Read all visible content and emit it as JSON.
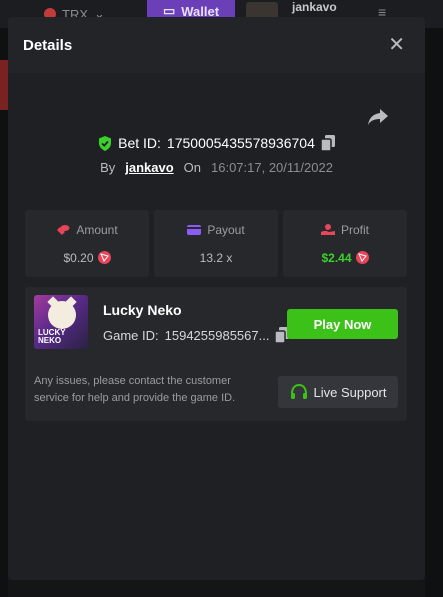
{
  "background": {
    "coin_label": "TRX",
    "wallet_label": "Wallet",
    "username": "jankavo"
  },
  "modal": {
    "title": "Details",
    "bet": {
      "bet_id_label": "Bet ID:",
      "bet_id": "1750005435578936704",
      "by_label": "By",
      "username": "jankavo",
      "on_label": "On",
      "timestamp": "16:07:17, 20/11/2022"
    },
    "stats": [
      {
        "label": "Amount",
        "value": "$0.20",
        "icon": "coins-icon",
        "color": "#e8445a"
      },
      {
        "label": "Payout",
        "value": "13.2 x",
        "icon": "wallet-icon",
        "color": "#8b5cf6"
      },
      {
        "label": "Profit",
        "value": "$2.44",
        "icon": "hand-coin-icon",
        "color": "#e8445a"
      }
    ],
    "game": {
      "name": "Lucky Neko",
      "thumb_text": "LUCKY NEKO",
      "game_id_label": "Game ID:",
      "game_id": "1594255985567...",
      "play_label": "Play Now",
      "issue_text": "Any issues, please contact the customer service for help and provide the game ID.",
      "support_label": "Live Support"
    }
  },
  "colors": {
    "accent_green": "#3bc117",
    "profit_green": "#3bd12a",
    "modal_bg": "#1f2023",
    "card_bg": "#27282c"
  }
}
